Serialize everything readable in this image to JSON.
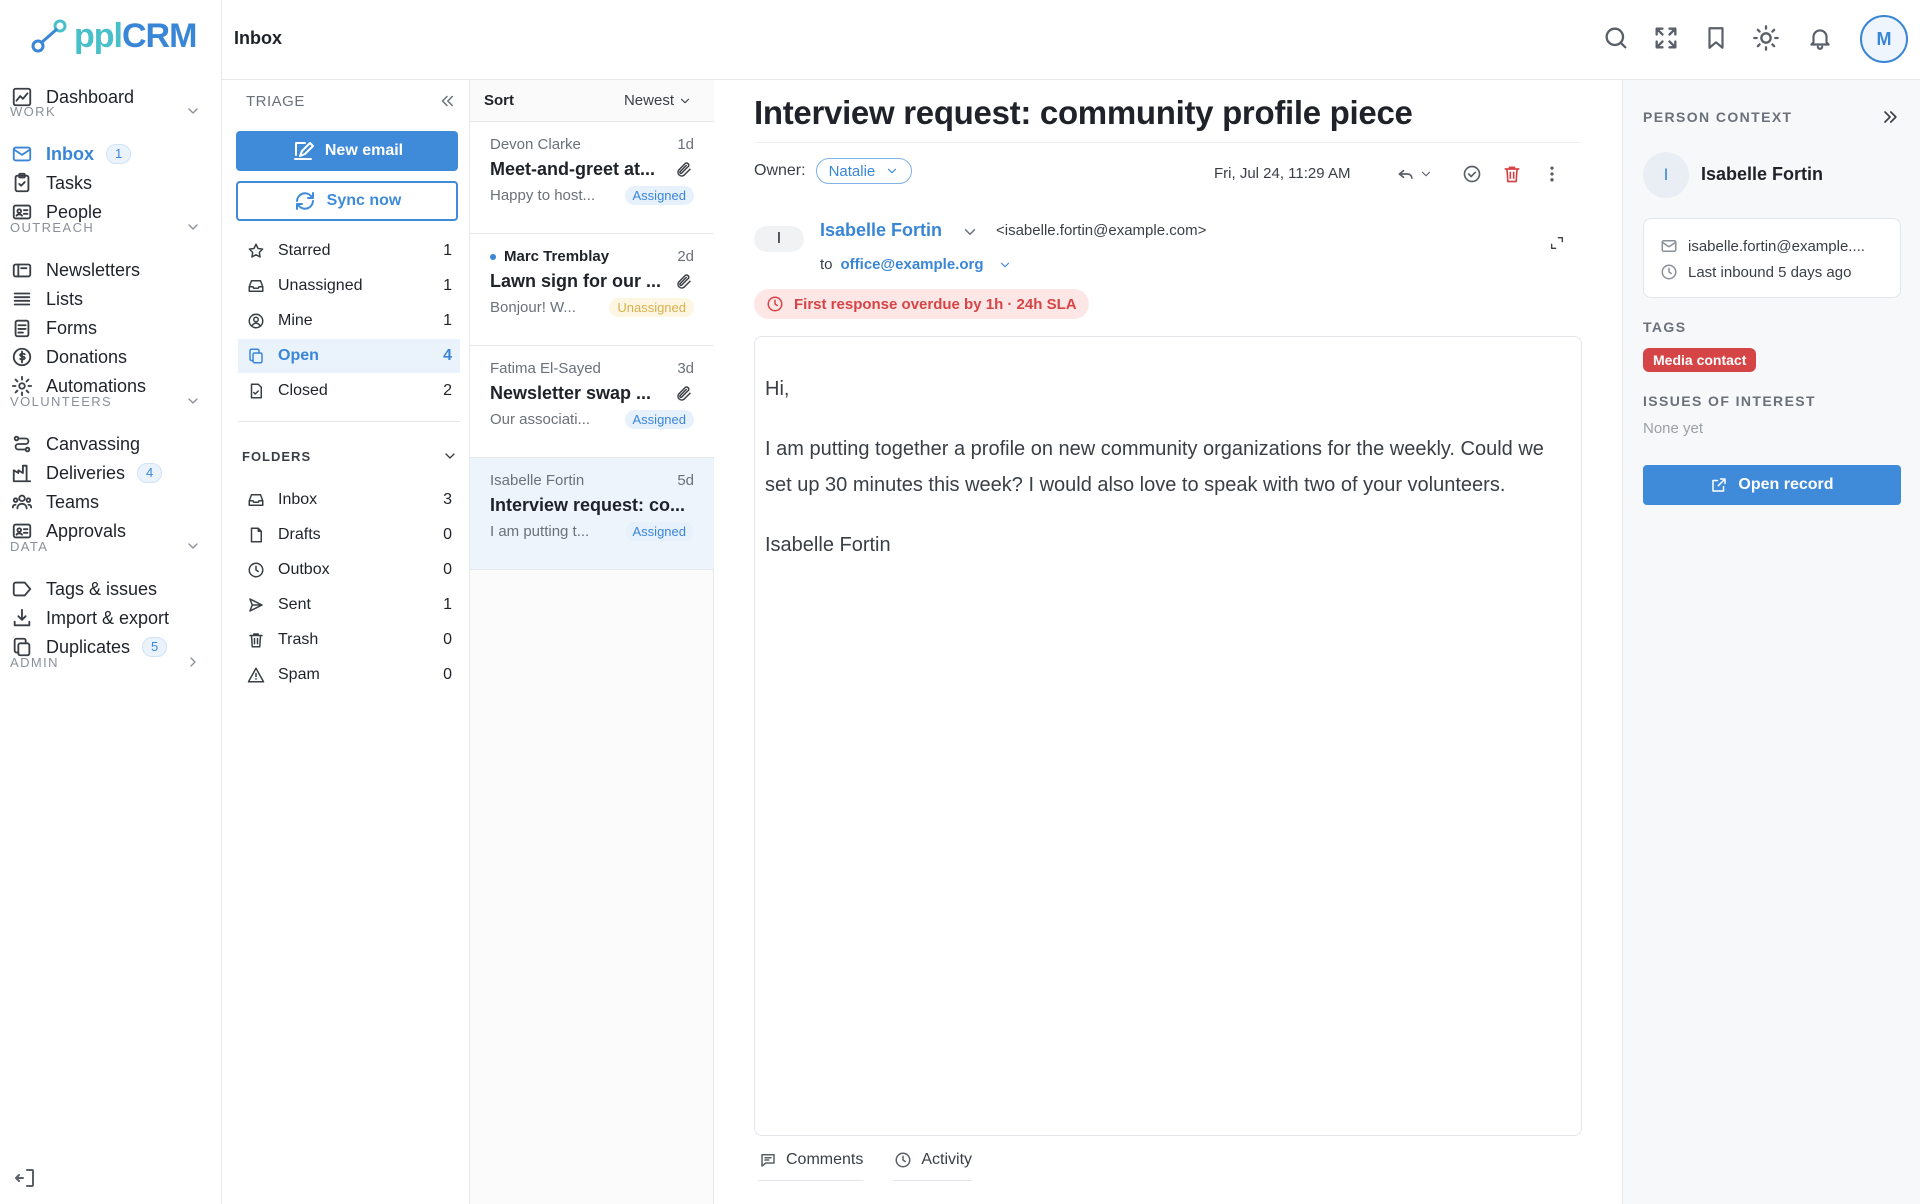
{
  "app": {
    "logo_text": "pplCRM",
    "brand_color": "#3a86d6"
  },
  "topbar": {
    "title": "Inbox",
    "avatar_initial": "M"
  },
  "nav": {
    "items": [
      {
        "key": "dashboard",
        "label": "Dashboard",
        "icon": "dashboard-icon"
      },
      {
        "key": "inbox",
        "label": "Inbox",
        "icon": "mail-icon",
        "badge": "1",
        "active": true
      },
      {
        "key": "tasks",
        "label": "Tasks",
        "icon": "clipboard-icon"
      },
      {
        "key": "people",
        "label": "People",
        "icon": "contact-card-icon"
      },
      {
        "key": "newsletters",
        "label": "Newsletters",
        "icon": "newsletter-icon"
      },
      {
        "key": "lists",
        "label": "Lists",
        "icon": "list-icon"
      },
      {
        "key": "forms",
        "label": "Forms",
        "icon": "form-icon"
      },
      {
        "key": "donations",
        "label": "Donations",
        "icon": "dollar-icon"
      },
      {
        "key": "automations",
        "label": "Automations",
        "icon": "cog-icon"
      },
      {
        "key": "canvassing",
        "label": "Canvassing",
        "icon": "route-icon"
      },
      {
        "key": "deliveries",
        "label": "Deliveries",
        "icon": "factory-icon",
        "badge": "4"
      },
      {
        "key": "teams",
        "label": "Teams",
        "icon": "team-icon"
      },
      {
        "key": "approvals",
        "label": "Approvals",
        "icon": "contact-card-icon"
      },
      {
        "key": "tags",
        "label": "Tags & issues",
        "icon": "tag-icon"
      },
      {
        "key": "import",
        "label": "Import & export",
        "icon": "import-icon"
      },
      {
        "key": "duplicates",
        "label": "Duplicates",
        "icon": "copy-icon",
        "badge": "5"
      }
    ],
    "sections": {
      "work": "WORK",
      "outreach": "OUTREACH",
      "volunteers": "VOLUNTEERS",
      "data": "DATA",
      "admin": "ADMIN"
    }
  },
  "triage": {
    "header": "TRIAGE",
    "new_email": "New email",
    "sync_now": "Sync now",
    "filters": [
      {
        "label": "Starred",
        "count": "1",
        "icon": "star-icon"
      },
      {
        "label": "Unassigned",
        "count": "1",
        "icon": "inbox-tray-icon"
      },
      {
        "label": "Mine",
        "count": "1",
        "icon": "user-circle-icon"
      },
      {
        "label": "Open",
        "count": "4",
        "icon": "copy-icon",
        "active": true
      },
      {
        "label": "Closed",
        "count": "2",
        "icon": "file-check-icon"
      }
    ],
    "folders_header": "FOLDERS",
    "folders": [
      {
        "label": "Inbox",
        "count": "3",
        "icon": "inbox-tray-icon"
      },
      {
        "label": "Drafts",
        "count": "0",
        "icon": "file-icon"
      },
      {
        "label": "Outbox",
        "count": "0",
        "icon": "clock-icon"
      },
      {
        "label": "Sent",
        "count": "1",
        "icon": "send-icon"
      },
      {
        "label": "Trash",
        "count": "0",
        "icon": "trash-icon"
      },
      {
        "label": "Spam",
        "count": "0",
        "icon": "warning-icon"
      }
    ]
  },
  "list": {
    "sort_label": "Sort",
    "sort_value": "Newest",
    "messages": [
      {
        "from": "Devon Clarke",
        "age": "1d",
        "subject": "Meet-and-greet at...",
        "preview": "Happy to host...",
        "status": "Assigned",
        "unread": false,
        "attachment": true
      },
      {
        "from": "Marc Tremblay",
        "age": "2d",
        "subject": "Lawn sign for our ...",
        "preview": "Bonjour! W...",
        "status": "Unassigned",
        "unread": true,
        "attachment": true
      },
      {
        "from": "Fatima El-Sayed",
        "age": "3d",
        "subject": "Newsletter swap ...",
        "preview": "Our associati...",
        "status": "Assigned",
        "unread": false,
        "attachment": true
      },
      {
        "from": "Isabelle Fortin",
        "age": "5d",
        "subject": "Interview request: co...",
        "preview": "I am putting t...",
        "status": "Assigned",
        "unread": false,
        "attachment": false,
        "selected": true
      }
    ]
  },
  "email": {
    "subject": "Interview request: community profile piece",
    "owner_label": "Owner:",
    "owner_value": "Natalie",
    "date": "Fri, Jul 24, 11:29 AM",
    "sender_initial": "I",
    "sender_name": "Isabelle Fortin",
    "sender_email": "<isabelle.fortin@example.com>",
    "to_label": "to",
    "to_address": "office@example.org",
    "sla": "First response overdue by 1h · 24h SLA",
    "body": {
      "greeting": "Hi,",
      "paragraph": "I am putting together a profile on new community organizations for the weekly. Could we set up 30 minutes this week? I would also love to speak with two of your volunteers.",
      "signature": "Isabelle Fortin"
    },
    "tabs": {
      "comments": "Comments",
      "activity": "Activity"
    }
  },
  "person": {
    "header": "PERSON CONTEXT",
    "initial": "I",
    "name": "Isabelle Fortin",
    "email": "isabelle.fortin@example....",
    "last_inbound": "Last inbound 5 days ago",
    "tags_label": "TAGS",
    "tag": "Media contact",
    "issues_label": "ISSUES OF INTEREST",
    "issues_value": "None yet",
    "open_record": "Open record"
  },
  "colors": {
    "accent": "#3f8bd9",
    "danger": "#d64545",
    "warning": "#d9b04d"
  }
}
